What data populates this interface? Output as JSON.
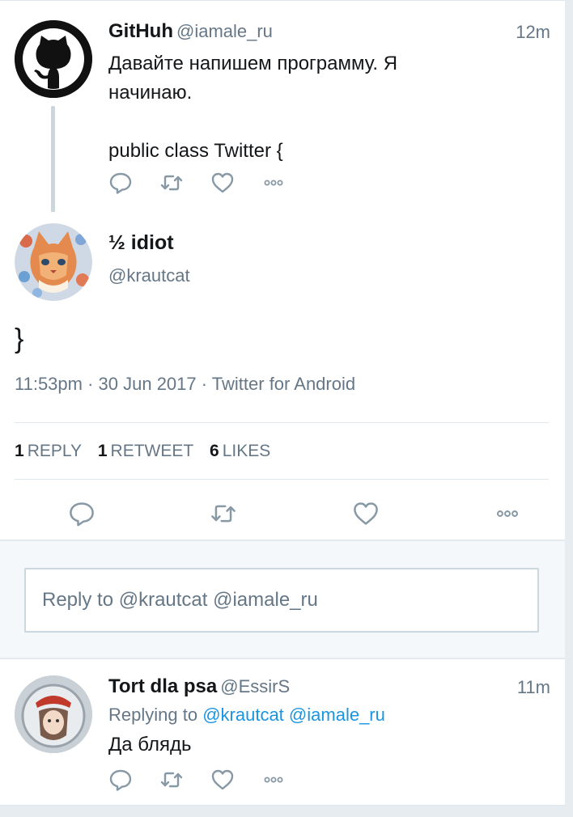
{
  "parent_tweet": {
    "display_name": "GitHuh",
    "handle": "@iamale_ru",
    "time": "12m",
    "text_line1": "Давайте напишем программу. Я",
    "text_line2": "начинаю.",
    "text_line3": "public class Twitter {"
  },
  "main_tweet": {
    "display_name": "½ idiot",
    "handle": "@krautcat",
    "text": "}",
    "meta": "11:53pm · 30 Jun 2017 · Twitter for Android",
    "stats": {
      "replies_count": "1",
      "replies_label": "REPLY",
      "retweets_count": "1",
      "retweets_label": "RETWEET",
      "likes_count": "6",
      "likes_label": "LIKES"
    }
  },
  "reply_box": {
    "placeholder": "Reply to @krautcat @iamale_ru"
  },
  "reply_tweet": {
    "display_name": "Tort dla psa",
    "handle": "@EssirS",
    "time": "11m",
    "replying_prefix": "Replying to",
    "replying_to_1": "@krautcat",
    "replying_to_2": "@iamale_ru",
    "text": "Да блядь"
  },
  "icons": {
    "reply": "reply-icon",
    "retweet": "retweet-icon",
    "like": "heart-icon",
    "more": "more-icon"
  },
  "colors": {
    "link": "#1b95e0",
    "secondary_text": "#657786",
    "icon": "#8899a6",
    "background": "#e6ecf0"
  }
}
